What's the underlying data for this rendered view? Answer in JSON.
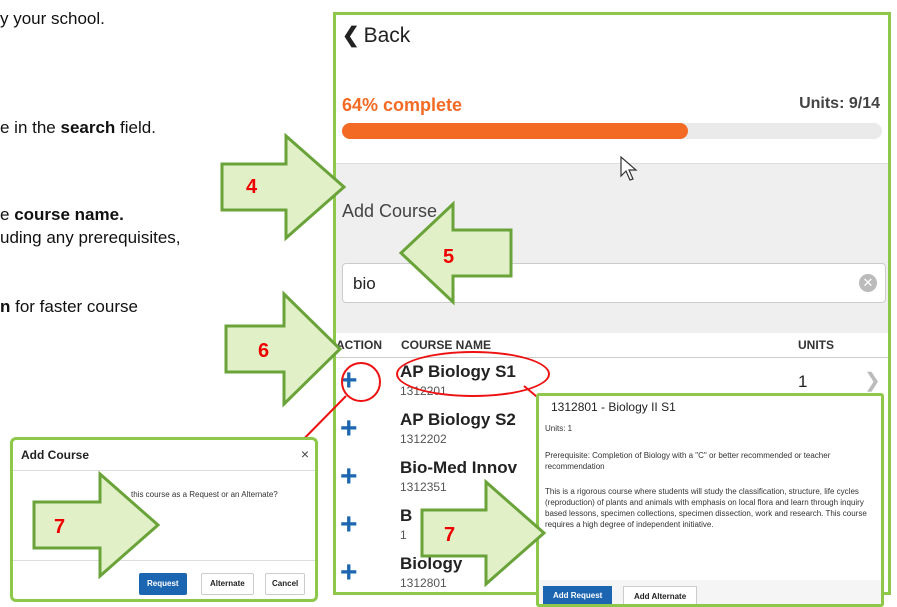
{
  "instructions": {
    "line1": "y your school.",
    "line2_pre": "e in the ",
    "line2_bold": "search",
    "line2_post": " field.",
    "line3_pre": "e ",
    "line3_bold": "course name.",
    "line4": "uding any prerequisites,",
    "line5_bold": "n",
    "line5_post": " for faster course"
  },
  "app": {
    "back_label": "Back",
    "progress_label": "64% complete",
    "progress_fraction": 0.64,
    "units_label": "Units: 9/14",
    "add_course_title": "Add Course",
    "search_value": "bio",
    "table": {
      "headers": [
        "ACTION",
        "COURSE NAME",
        "UNITS"
      ],
      "rows": [
        {
          "name": "AP Biology S1",
          "number": "1312201",
          "units": "1"
        },
        {
          "name": "AP Biology S2",
          "number": "1312202",
          "units": ""
        },
        {
          "name": "Bio-Med Innov",
          "number": "1312351",
          "units": ""
        },
        {
          "name": "B",
          "number": "1",
          "units": ""
        },
        {
          "name": "Biology",
          "number": "1312801",
          "units": ""
        }
      ]
    }
  },
  "detail_popup": {
    "title": "1312801 - Biology II S1",
    "units": "Units: 1",
    "prereq": "Prerequisite: Completion of Biology with a \"C\" or better recommended or teacher recommendation",
    "description": "This is a rigorous course where students will study the classification, structure, life cycles (reproduction) of plants and animals with emphasis on local flora and learn through inquiry based lessons, specimen collections, specimen dissection, work and research. This course requires a high degree of independent initiative.",
    "add_request": "Add Request",
    "add_alternate": "Add Alternate"
  },
  "modal": {
    "title": "Add Course",
    "close": "×",
    "question": "this course as a Request or an Alternate?",
    "request": "Request",
    "alternate": "Alternate",
    "cancel": "Cancel"
  },
  "callouts": {
    "step4": "4",
    "step5": "5",
    "step6": "6",
    "step7a": "7",
    "step7b": "7",
    "arrow_fill": "#e2f0c8",
    "arrow_stroke": "#6aa33a",
    "highlight": "#e11111"
  }
}
